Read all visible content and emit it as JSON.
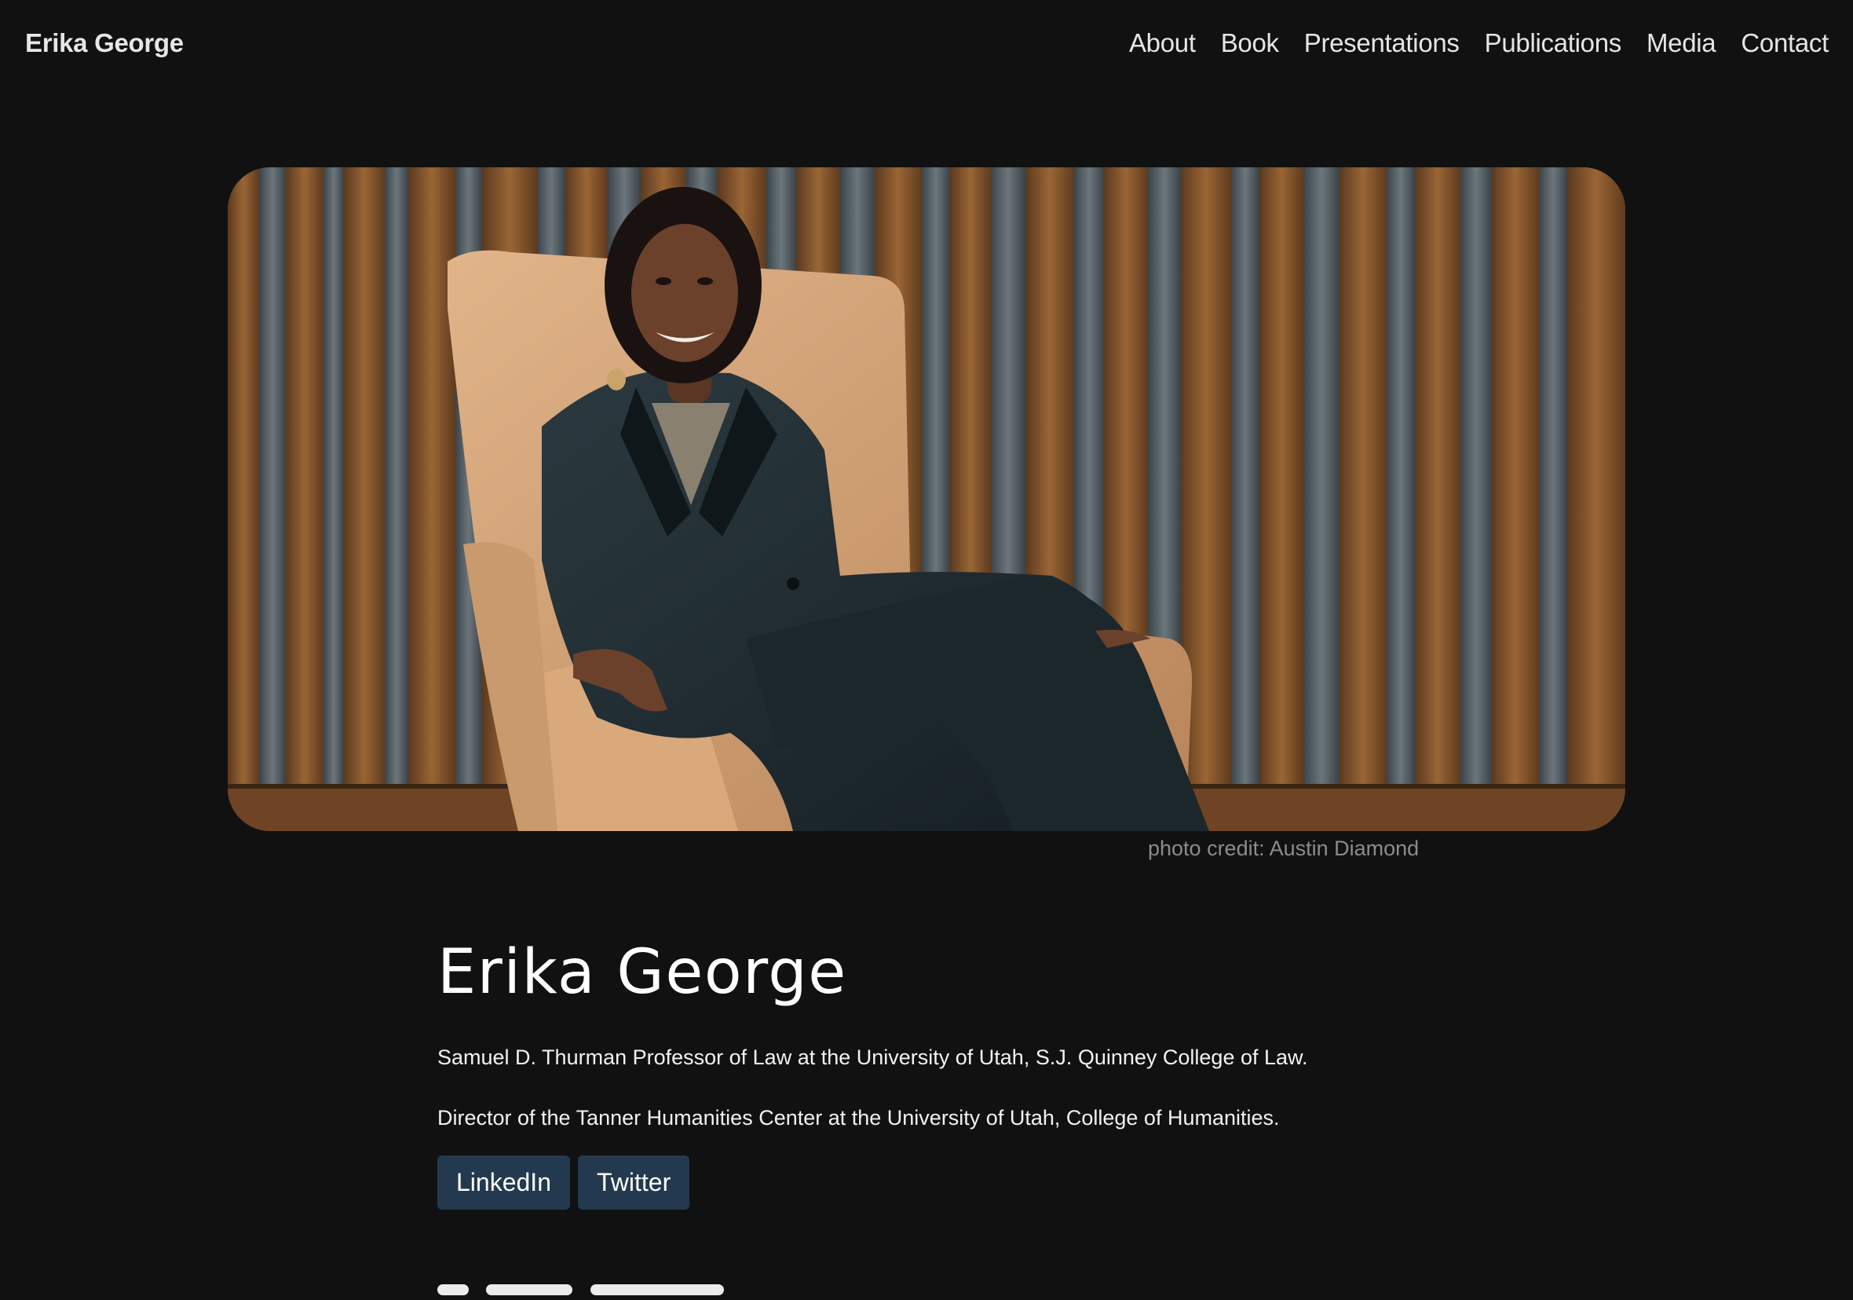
{
  "header": {
    "brand": "Erika George",
    "nav": [
      "About",
      "Book",
      "Presentations",
      "Publications",
      "Media",
      "Contact"
    ]
  },
  "hero": {
    "image": "portrait-photo",
    "credit": "photo credit: Austin Diamond"
  },
  "profile": {
    "name": "Erika George",
    "roles": [
      "Samuel D. Thurman Professor of Law at the University of Utah, S.J. Quinney College of Law.",
      "Director of the Tanner Humanities Center at the University of Utah, College of Humanities."
    ],
    "links": [
      "LinkedIn",
      "Twitter"
    ]
  },
  "colors": {
    "background": "#111111",
    "button": "#23394f",
    "text": "#f0f0f0",
    "muted": "#8c8c8c"
  }
}
